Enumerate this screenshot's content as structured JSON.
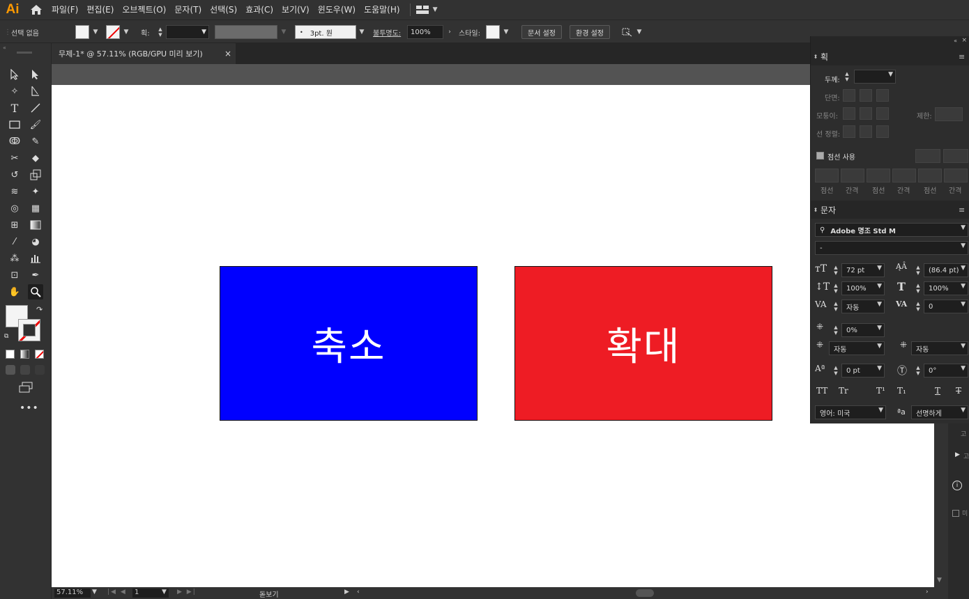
{
  "app": {
    "logo": "Ai",
    "menus": [
      "파일(F)",
      "편집(E)",
      "오브젝트(O)",
      "문자(T)",
      "선택(S)",
      "효과(C)",
      "보기(V)",
      "윈도우(W)",
      "도움말(H)"
    ]
  },
  "control": {
    "selection": "선택 없음",
    "stroke_label": "획:",
    "brush": "3pt. 원",
    "opacity_label": "불투명도:",
    "opacity": "100%",
    "style_label": "스타일:",
    "doc_setup": "문서 설정",
    "prefs": "환경 설정"
  },
  "document": {
    "tab_title": "무제-1* @ 57.11% (RGB/GPU 미리 보기)",
    "close": "×"
  },
  "canvas": {
    "shapes": [
      {
        "label": "축소",
        "color": "#0000ff"
      },
      {
        "label": "확대",
        "color": "#ee1c24"
      }
    ]
  },
  "status": {
    "zoom": "57.11%",
    "page": "1",
    "tool_name": "돋보기"
  },
  "stroke_panel": {
    "title": "획",
    "weight_label": "두께:",
    "cap_label": "단면:",
    "corner_label": "모퉁이:",
    "limit_label": "제한:",
    "align_label": "선 정렬:",
    "dashed_label": "점선 사용",
    "dash_labels": [
      "점선",
      "간격",
      "점선",
      "간격",
      "점선",
      "간격"
    ]
  },
  "char_panel": {
    "title": "문자",
    "font": "Adobe 명조 Std M",
    "style": "-",
    "size": "72 pt",
    "leading": "(86.4 pt)",
    "vscale": "100%",
    "hscale": "100%",
    "kerning": "자동",
    "tracking": "0",
    "tsume": "0%",
    "aki_left": "자동",
    "aki_right": "자동",
    "baseline": "0 pt",
    "rotation": "0°",
    "glyph_buttons": [
      "TT",
      "Tr",
      "T¹",
      "T₁",
      "T",
      "T"
    ],
    "language": "영어: 미국",
    "antialias_icon": "ªa",
    "antialias": "선명하게"
  },
  "right_dock": {
    "label_a": "고",
    "label_b": "고",
    "label_c": "미"
  }
}
